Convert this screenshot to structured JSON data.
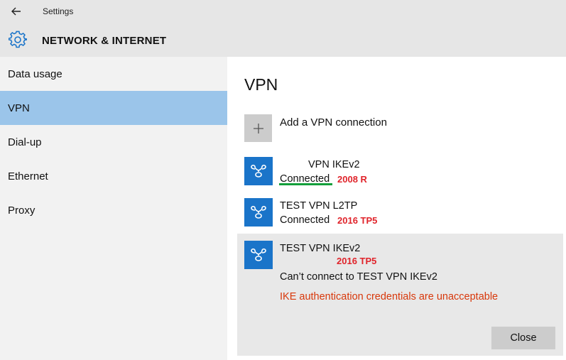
{
  "window": {
    "title": "Settings",
    "back_icon": "back-arrow-icon"
  },
  "header": {
    "title": "NETWORK & INTERNET",
    "icon": "gear-icon"
  },
  "sidebar": {
    "items": [
      {
        "label": "Data usage",
        "selected": false
      },
      {
        "label": "VPN",
        "selected": true
      },
      {
        "label": "Dial-up",
        "selected": false
      },
      {
        "label": "Ethernet",
        "selected": false
      },
      {
        "label": "Proxy",
        "selected": false
      }
    ]
  },
  "main": {
    "title": "VPN",
    "add_label": "Add a VPN connection",
    "connections": [
      {
        "name": "VPN IKEv2",
        "status": "Connected",
        "annotation": "2008 R"
      },
      {
        "name": "TEST VPN L2TP",
        "status": "Connected",
        "annotation": "2016 TP5"
      },
      {
        "name": "TEST VPN IKEv2",
        "annotation": "2016 TP5",
        "status": "Can’t connect to TEST VPN IKEv2",
        "error": "IKE authentication credentials are unacceptable",
        "close_label": "Close"
      }
    ]
  },
  "colors": {
    "accent": "#1a74c9",
    "selected_nav": "#9bc5ea",
    "annotation": "#e0242b",
    "error": "#d8380b",
    "underline": "#139f3b"
  }
}
